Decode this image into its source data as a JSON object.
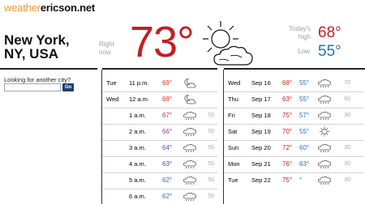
{
  "site": {
    "logo_left": "weather",
    "logo_right": "ericson.net"
  },
  "current": {
    "city": "New York, NY, USA",
    "right_now_label": "Right now",
    "temp": "73°",
    "condition_icon": "sun-cloud-icon",
    "high_label": "Today's high",
    "high": "68°",
    "low_label": "Low",
    "low": "55°"
  },
  "search": {
    "label": "Looking for another city?",
    "value": "",
    "go_label": "Go"
  },
  "colors": {
    "high": "#c41e23",
    "low": "#1e73be",
    "logo_accent": "#e89a3c",
    "button": "#1d3f6e"
  },
  "hourly": [
    {
      "day": "Tue",
      "time": "11 p.m.",
      "temp": "69°",
      "temp_color": "#c0392b",
      "icon": "moon-cloud-icon",
      "pct": ""
    },
    {
      "day": "Wed",
      "time": "12 a.m.",
      "temp": "68°",
      "temp_color": "#c0392b",
      "icon": "moon-cloud-icon",
      "pct": ""
    },
    {
      "day": "",
      "time": "1 a.m.",
      "temp": "67°",
      "temp_color": "#b03a48",
      "icon": "rain-cloud-icon",
      "pct": "50"
    },
    {
      "day": "",
      "time": "2 a.m.",
      "temp": "66°",
      "temp_color": "#8e3a7e",
      "icon": "rain-cloud-icon",
      "pct": "50"
    },
    {
      "day": "",
      "time": "3 a.m.",
      "temp": "64°",
      "temp_color": "#6b3fa0",
      "icon": "rain-cloud-icon",
      "pct": "50"
    },
    {
      "day": "",
      "time": "4 a.m.",
      "temp": "63°",
      "temp_color": "#4a4aa8",
      "icon": "rain-cloud-icon",
      "pct": "50"
    },
    {
      "day": "",
      "time": "5 a.m.",
      "temp": "62°",
      "temp_color": "#2f6fb0",
      "icon": "rain-cloud-icon",
      "pct": "50"
    },
    {
      "day": "",
      "time": "6 a.m.",
      "temp": "62°",
      "temp_color": "#2f6fb0",
      "icon": "rain-cloud-icon",
      "pct": "50"
    }
  ],
  "daily": [
    {
      "day": "Wed",
      "date": "Sep 16",
      "high": "68°",
      "low": "55°",
      "icon": "rain-cloud-icon",
      "pct": "70"
    },
    {
      "day": "Thu",
      "date": "Sep 17",
      "high": "63°",
      "low": "55°",
      "icon": "rain-cloud-icon",
      "pct": "60"
    },
    {
      "day": "Fri",
      "date": "Sep 18",
      "high": "75°",
      "low": "57°",
      "icon": "rain-cloud-icon",
      "pct": "30"
    },
    {
      "day": "Sat",
      "date": "Sep 19",
      "high": "70°",
      "low": "55°",
      "icon": "sun-icon",
      "pct": ""
    },
    {
      "day": "Sun",
      "date": "Sep 20",
      "high": "72°",
      "low": "60°",
      "icon": "rain-cloud-icon",
      "pct": "30"
    },
    {
      "day": "Mon",
      "date": "Sep 21",
      "high": "76°",
      "low": "63°",
      "icon": "rain-cloud-icon",
      "pct": "30"
    },
    {
      "day": "Tue",
      "date": "Sep 22",
      "high": "75°",
      "low": "°",
      "icon": "rain-cloud-icon",
      "pct": "30"
    }
  ]
}
